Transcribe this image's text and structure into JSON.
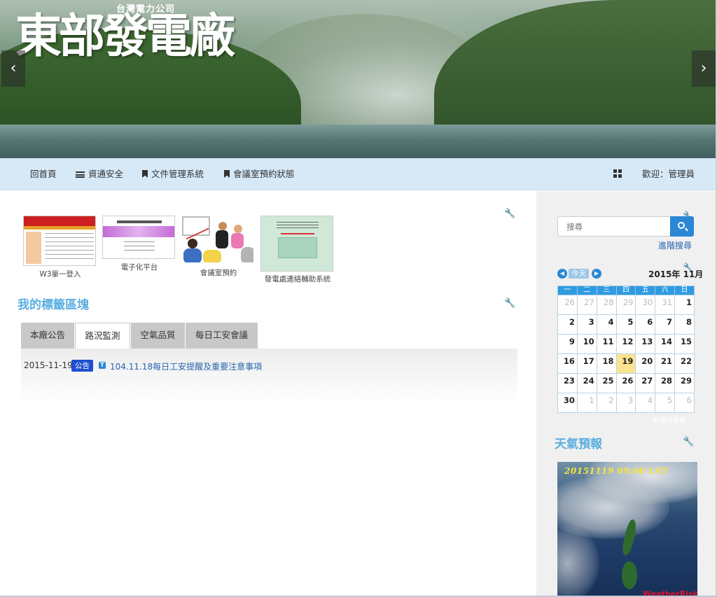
{
  "banner": {
    "logo_text": "東部發電廠",
    "logo_subtitle": "台灣電力公司",
    "prev_arrow": "‹",
    "next_arrow": "›"
  },
  "nav": {
    "items": [
      {
        "label": "回首頁",
        "icon": "none"
      },
      {
        "label": "資通安全",
        "icon": "list-icon"
      },
      {
        "label": "文件管理系統",
        "icon": "bookmark-icon"
      },
      {
        "label": "會議室預約狀態",
        "icon": "bookmark-icon"
      }
    ],
    "grid_icon": "grid-icon",
    "welcome": "歡迎：管理員"
  },
  "shortcuts": [
    {
      "label": "W3單一登入"
    },
    {
      "label": "電子化平台"
    },
    {
      "label": "會議室預約"
    },
    {
      "label": "發電處連絡輔助系統"
    }
  ],
  "tags_block": {
    "title": "我的標籤區塊",
    "tabs": [
      "本廠公告",
      "路況監測",
      "空氣品質",
      "每日工安會議"
    ],
    "active_tab_index": 1,
    "news": [
      {
        "date": "2015-11-19",
        "badge": "公告",
        "title": "104.11.18每日工安提醒及重要注意事項"
      }
    ]
  },
  "sidebar": {
    "search": {
      "placeholder": "搜尋",
      "advanced_label": "進階搜尋"
    },
    "calendar": {
      "today_label": "今天",
      "month_label": "2015年 11月",
      "weekdays": [
        "一",
        "二",
        "三",
        "四",
        "五",
        "六",
        "日"
      ],
      "weeks": [
        [
          {
            "d": "26",
            "o": true
          },
          {
            "d": "27",
            "o": true
          },
          {
            "d": "28",
            "o": true
          },
          {
            "d": "29",
            "o": true
          },
          {
            "d": "30",
            "o": true
          },
          {
            "d": "31",
            "o": true
          },
          {
            "d": "1",
            "o": false
          }
        ],
        [
          {
            "d": "2",
            "o": false
          },
          {
            "d": "3",
            "o": false
          },
          {
            "d": "4",
            "o": false
          },
          {
            "d": "5",
            "o": false
          },
          {
            "d": "6",
            "o": false
          },
          {
            "d": "7",
            "o": false
          },
          {
            "d": "8",
            "o": false
          }
        ],
        [
          {
            "d": "9",
            "o": false
          },
          {
            "d": "10",
            "o": false
          },
          {
            "d": "11",
            "o": false
          },
          {
            "d": "12",
            "o": false
          },
          {
            "d": "13",
            "o": false
          },
          {
            "d": "14",
            "o": false
          },
          {
            "d": "15",
            "o": false
          }
        ],
        [
          {
            "d": "16",
            "o": false
          },
          {
            "d": "17",
            "o": false
          },
          {
            "d": "18",
            "o": false
          },
          {
            "d": "19",
            "o": false,
            "today": true
          },
          {
            "d": "20",
            "o": false
          },
          {
            "d": "21",
            "o": false
          },
          {
            "d": "22",
            "o": false
          }
        ],
        [
          {
            "d": "23",
            "o": false
          },
          {
            "d": "24",
            "o": false
          },
          {
            "d": "25",
            "o": false
          },
          {
            "d": "26",
            "o": false
          },
          {
            "d": "27",
            "o": false
          },
          {
            "d": "28",
            "o": false
          },
          {
            "d": "29",
            "o": false
          }
        ],
        [
          {
            "d": "30",
            "o": false
          },
          {
            "d": "1",
            "o": true
          },
          {
            "d": "2",
            "o": true
          },
          {
            "d": "3",
            "o": true
          },
          {
            "d": "4",
            "o": true
          },
          {
            "d": "5",
            "o": true
          },
          {
            "d": "6",
            "o": true
          }
        ]
      ],
      "footer_label": "新增行事曆"
    },
    "weather": {
      "title": "天氣預報",
      "image_stamp": "20151119 09:00 LST",
      "image_brand": "WeatherRisk"
    }
  },
  "colors": {
    "accent": "#2a87d6",
    "section_title": "#5aaee0",
    "nav_bg": "#d7e9f7",
    "today_highlight": "#fbe38f",
    "badge": "#1f4fd0"
  }
}
